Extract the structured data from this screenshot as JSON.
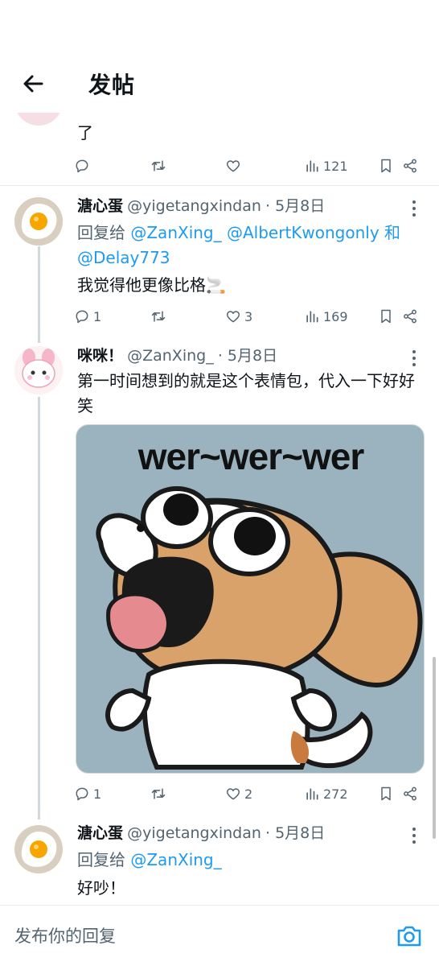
{
  "header": {
    "title": "发帖"
  },
  "prev_post": {
    "text_tail": "了",
    "stats": {
      "views": "121"
    }
  },
  "posts": [
    {
      "name": "溏心蛋",
      "handle": "@yigetangxindan",
      "date": "· 5月8日",
      "reply_to_label": "回复给",
      "mentions": [
        "@ZanXing_",
        "@AlbertKwongonly",
        "@Delay773"
      ],
      "joiner": "和",
      "text": "我觉得他更像比格🚬",
      "stats": {
        "replies": "1",
        "likes": "3",
        "views": "169"
      }
    },
    {
      "name": "咪咪！",
      "handle": "@ZanXing_",
      "date": "· 5月8日",
      "text": "第一时间想到的就是这个表情包，代入一下好好笑",
      "image_caption": "wer~wer~wer",
      "stats": {
        "replies": "1",
        "likes": "2",
        "views": "272"
      }
    },
    {
      "name": "溏心蛋",
      "handle": "@yigetangxindan",
      "date": "· 5月8日",
      "reply_to_label": "回复给",
      "mentions": [
        "@ZanXing_"
      ],
      "text": "好吵！"
    }
  ],
  "reply_bar": {
    "placeholder": "发布你的回复"
  },
  "icons": {
    "back": "arrow-left-icon",
    "reply": "comment-icon",
    "retweet": "retweet-icon",
    "like": "heart-icon",
    "views": "bar-chart-icon",
    "bookmark": "bookmark-icon",
    "share": "share-icon",
    "more": "more-vertical-icon",
    "camera": "camera-icon"
  },
  "colors": {
    "link": "#1d9bf0",
    "secondary": "#536471",
    "divider": "#e6ecf0"
  }
}
